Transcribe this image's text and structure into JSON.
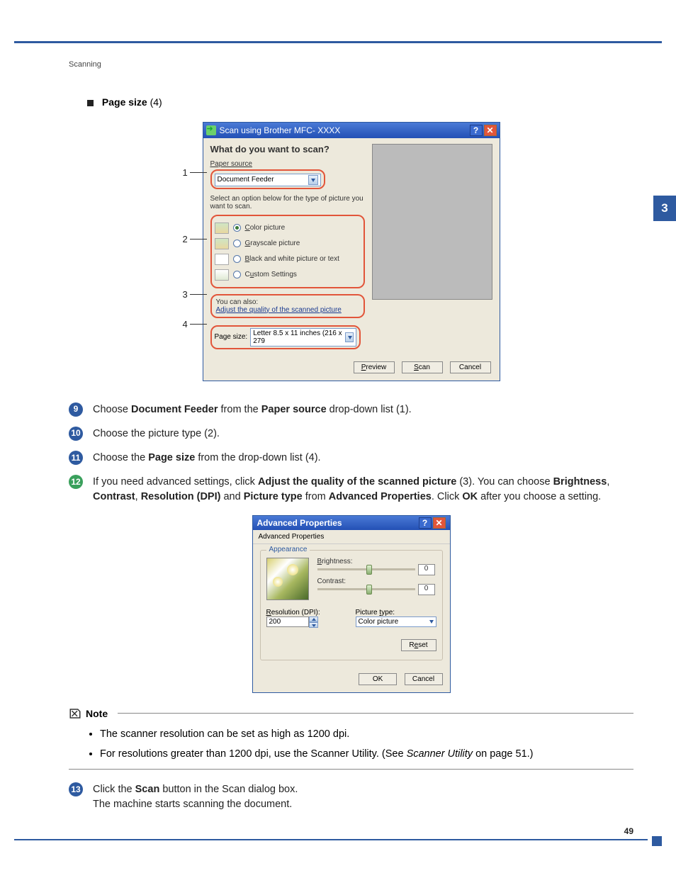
{
  "header": {
    "section": "Scanning"
  },
  "sideTab": "3",
  "pageSizeBullet": {
    "label": "Page size",
    "num": "(4)"
  },
  "scanDialog": {
    "title": "Scan using Brother MFC- XXXX",
    "heading": "What do you want to scan?",
    "paperSourceLabel": "Paper source",
    "paperSourceValue": "Document Feeder",
    "selectText": "Select an option below for the type of picture you want to scan.",
    "opt1": "Color picture",
    "opt2": "Grayscale picture",
    "opt3": "Black and white picture or text",
    "opt4": "Custom Settings",
    "youCanAlso": "You can also:",
    "adjustLink": "Adjust the quality of the scanned picture",
    "pageSizeLbl": "Page size:",
    "pageSizeVal": "Letter 8.5 x 11 inches (216 x 279",
    "btnPreview": "Preview",
    "btnScan": "Scan",
    "btnCancel": "Cancel",
    "callouts": {
      "c1": "1",
      "c2": "2",
      "c3": "3",
      "c4": "4"
    }
  },
  "steps": {
    "s9": {
      "num": "9",
      "t1": "Choose ",
      "b1": "Document Feeder",
      "t2": " from the ",
      "b2": "Paper source",
      "t3": " drop-down list (1)."
    },
    "s10": {
      "num": "10",
      "text": "Choose the picture type (2)."
    },
    "s11": {
      "num": "11",
      "t1": "Choose the ",
      "b1": "Page size",
      "t2": " from the drop-down list (4)."
    },
    "s12": {
      "num": "12",
      "t1": "If you need advanced settings, click ",
      "b1": "Adjust the quality of the scanned picture",
      "t2": " (3). You can choose ",
      "b2": "Brightness",
      "t3": ", ",
      "b3": "Contrast",
      "t4": ", ",
      "b4": "Resolution (DPI)",
      "t5": " and ",
      "b5": "Picture type",
      "t6": " from ",
      "b6": "Advanced Properties",
      "t7": ". Click ",
      "b7": "OK",
      "t8": " after you choose a setting."
    },
    "s13": {
      "num": "13",
      "t1": "Click the ",
      "b1": "Scan",
      "t2": " button in the Scan dialog box.",
      "line2": "The machine starts scanning the document."
    }
  },
  "advDialog": {
    "title": "Advanced Properties",
    "tab": "Advanced Properties",
    "legend": "Appearance",
    "brightLabel": "Brightness:",
    "brightVal": "0",
    "contrastLabel": "Contrast:",
    "contrastVal": "0",
    "resLabel": "Resolution (DPI):",
    "resVal": "200",
    "picTypeLabel": "Picture type:",
    "picTypeVal": "Color picture",
    "reset": "Reset",
    "ok": "OK",
    "cancel": "Cancel"
  },
  "note": {
    "label": "Note",
    "n1": "The scanner resolution can be set as high as 1200 dpi.",
    "n2a": "For resolutions greater than 1200 dpi, use the Scanner Utility. (See ",
    "n2i": "Scanner Utility",
    "n2b": " on page 51.)"
  },
  "pageNum": "49"
}
